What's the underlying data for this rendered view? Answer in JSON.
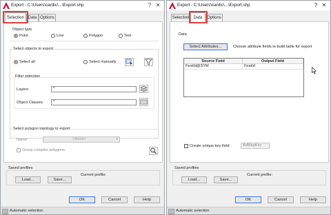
{
  "left_dialog": {
    "title": "Export - C:\\Users\\cardic\\...\\Export.shp",
    "tabs": [
      "Selection",
      "Data",
      "Options"
    ],
    "active_tab": "Selection",
    "object_type": {
      "label": "Object type",
      "options": [
        "Point",
        "Line",
        "Polygon",
        "Text"
      ],
      "selected": "Point"
    },
    "select_objects": {
      "label": "Select objects to export",
      "options": [
        "Select all",
        "Select manually"
      ],
      "selected": "Select all"
    },
    "filter": {
      "label": "Filter selection",
      "layers_label": "Layers:",
      "layers_value": "*",
      "classes_label": "Object Classes:",
      "classes_value": "*"
    },
    "topology": {
      "label": "Select polygon topology to export",
      "name_label": "Name:",
      "name_value": "<None>",
      "group_label": "Group complex polygons"
    },
    "saved_profiles": {
      "label": "Saved profiles",
      "load": "Load...",
      "save": "Save...",
      "current_label": "Current profile:"
    },
    "buttons": {
      "ok": "OK",
      "cancel": "Cancel",
      "help": "Help"
    },
    "status": "Automatic selection"
  },
  "right_dialog": {
    "title": "Export - C:\\Users\\cardic\\...\\Export.shp",
    "tabs": [
      "Selection",
      "Data",
      "Options"
    ],
    "active_tab": "Data",
    "data_label": "Data",
    "select_attributes_button": "Select Attributes...",
    "select_attributes_desc": "Choose attribute fields to build table for export",
    "table": {
      "headers": [
        "Source Field",
        "Output Field"
      ],
      "rows": [
        [
          "FeatId@SYM",
          "FeatId"
        ]
      ]
    },
    "unique_key_label": "Create unique key field:",
    "unique_key_value": "AdMapKey",
    "saved_profiles": {
      "label": "Saved profiles",
      "load": "Load...",
      "save": "Save...",
      "current_label": "Current profile:"
    },
    "buttons": {
      "ok": "OK",
      "cancel": "Cancel",
      "help": "Help"
    },
    "status": "Automatic selection"
  },
  "colors": {
    "highlight": "#e03c3c",
    "app_icon": "#c8102e",
    "default_button_border": "#3b78e7"
  }
}
